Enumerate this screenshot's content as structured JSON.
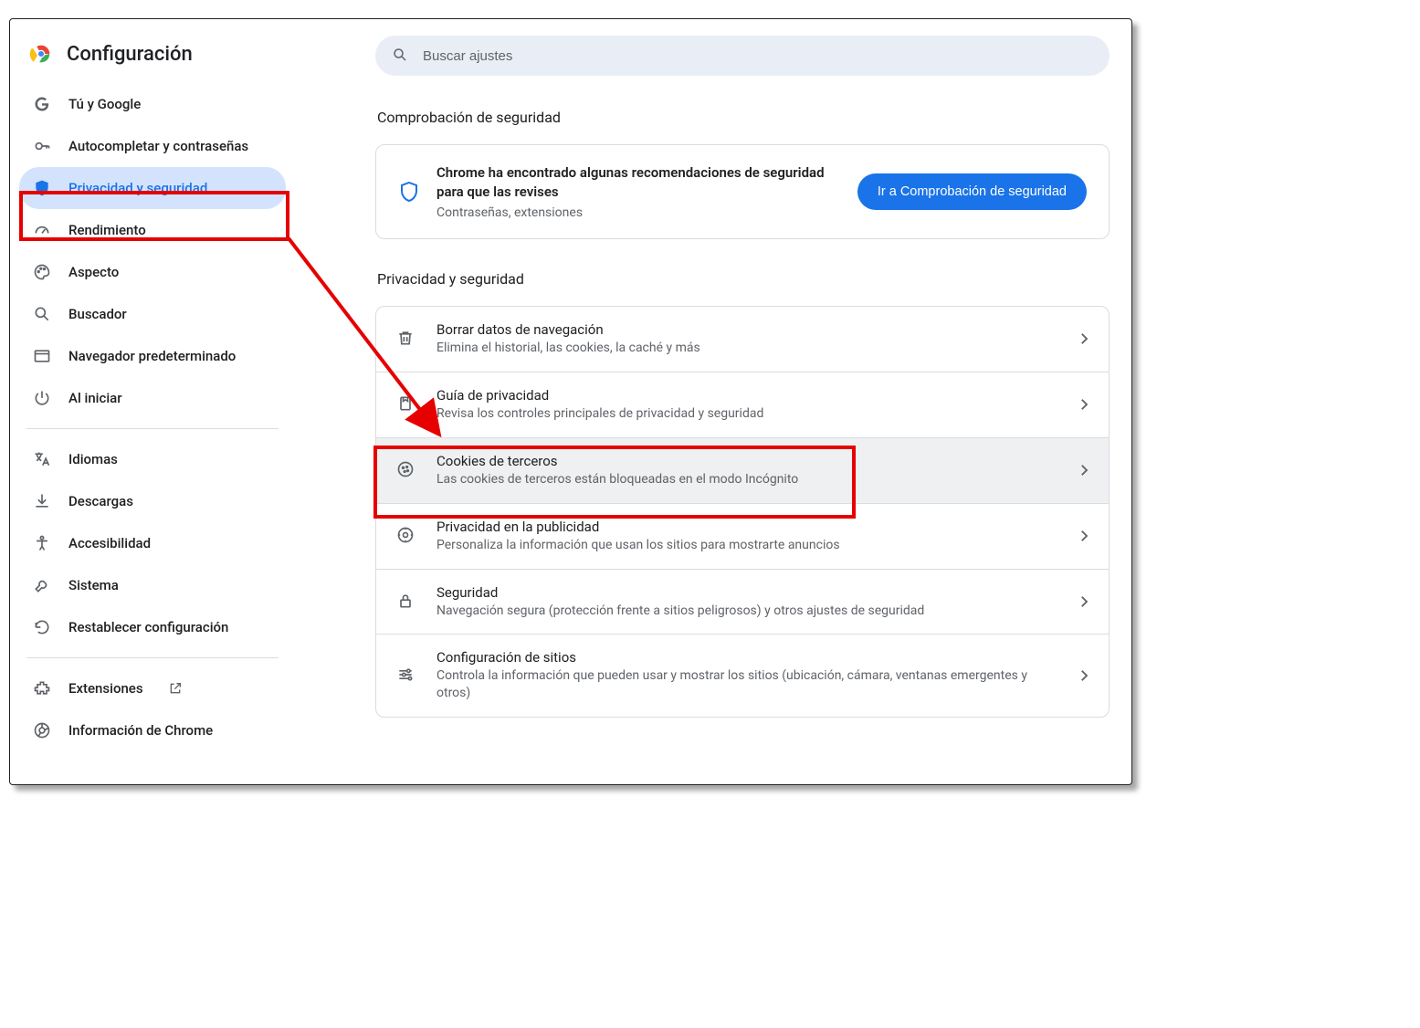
{
  "header": {
    "title": "Configuración"
  },
  "search": {
    "placeholder": "Buscar ajustes"
  },
  "sidebar": {
    "groups": [
      [
        {
          "id": "you-google",
          "label": "Tú y Google"
        },
        {
          "id": "autofill",
          "label": "Autocompletar y contraseñas"
        },
        {
          "id": "privacy",
          "label": "Privacidad y seguridad",
          "selected": true
        },
        {
          "id": "performance",
          "label": "Rendimiento"
        },
        {
          "id": "appearance",
          "label": "Aspecto"
        },
        {
          "id": "search-engine",
          "label": "Buscador"
        },
        {
          "id": "default-browser",
          "label": "Navegador predeterminado"
        },
        {
          "id": "on-startup",
          "label": "Al iniciar"
        }
      ],
      [
        {
          "id": "languages",
          "label": "Idiomas"
        },
        {
          "id": "downloads",
          "label": "Descargas"
        },
        {
          "id": "accessibility",
          "label": "Accesibilidad"
        },
        {
          "id": "system",
          "label": "Sistema"
        },
        {
          "id": "reset",
          "label": "Restablecer configuración"
        }
      ],
      [
        {
          "id": "extensions",
          "label": "Extensiones",
          "external": true
        },
        {
          "id": "about",
          "label": "Información de Chrome"
        }
      ]
    ]
  },
  "safety": {
    "section_label": "Comprobación de seguridad",
    "title": "Chrome ha encontrado algunas recomendaciones de seguridad para que las revises",
    "sub": "Contraseñas, extensiones",
    "button": "Ir a Comprobación de seguridad"
  },
  "privacy": {
    "section_label": "Privacidad y seguridad",
    "rows": [
      {
        "id": "clear-data",
        "title": "Borrar datos de navegación",
        "sub": "Elimina el historial, las cookies, la caché y más"
      },
      {
        "id": "privacy-guide",
        "title": "Guía de privacidad",
        "sub": "Revisa los controles principales de privacidad y seguridad"
      },
      {
        "id": "third-party-cookies",
        "title": "Cookies de terceros",
        "sub": "Las cookies de terceros están bloqueadas en el modo Incógnito",
        "hover": true
      },
      {
        "id": "ad-privacy",
        "title": "Privacidad en la publicidad",
        "sub": "Personaliza la información que usan los sitios para mostrarte anuncios"
      },
      {
        "id": "security",
        "title": "Seguridad",
        "sub": "Navegación segura (protección frente a sitios peligrosos) y otros ajustes de seguridad"
      },
      {
        "id": "site-settings",
        "title": "Configuración de sitios",
        "sub": "Controla la información que pueden usar y mostrar los sitios (ubicación, cámara, ventanas emergentes y otros)"
      }
    ]
  },
  "annotations": {
    "highlight_sidebar_item": "privacy",
    "highlight_row": "third-party-cookies",
    "arrow_color": "#e60000"
  }
}
